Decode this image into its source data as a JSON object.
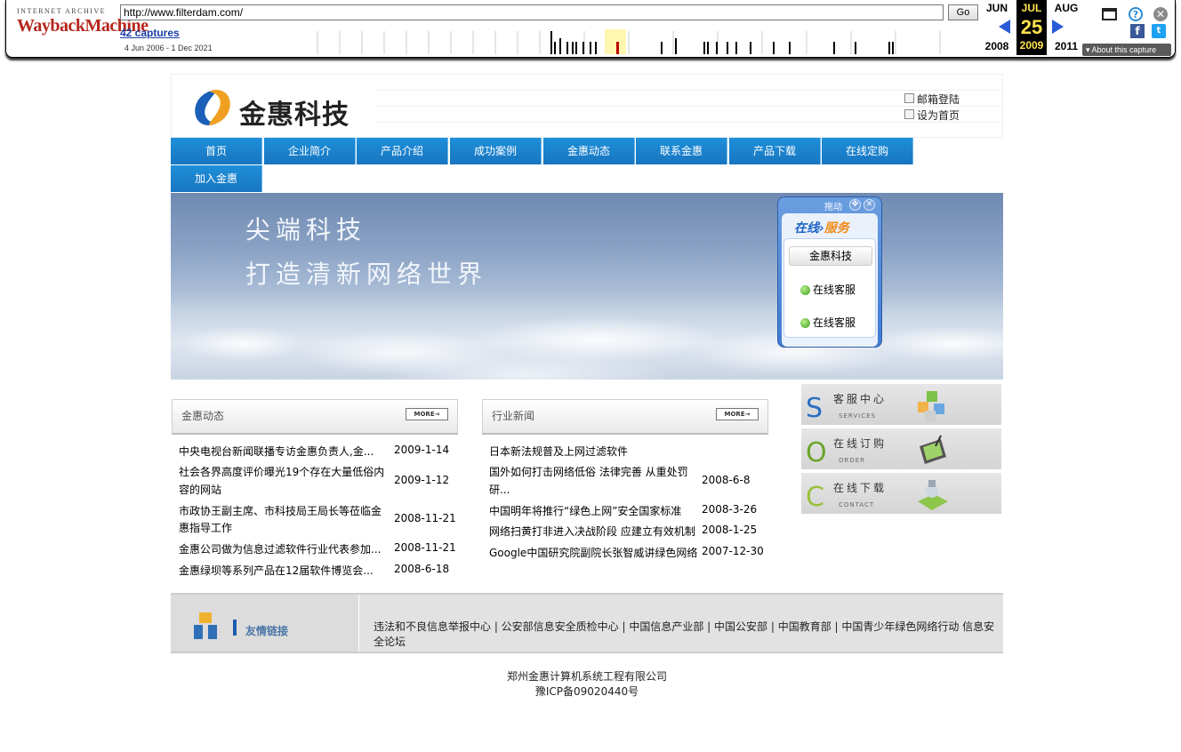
{
  "wayback": {
    "logo_top": "INTERNET ARCHIVE",
    "logo_main": "WaybackMachine",
    "url": "http://www.filterdam.com/",
    "go_label": "Go",
    "captures": "42 captures",
    "range": "4 Jun 2006 - 1 Dec 2021",
    "prev_month": "JUN",
    "cur_month": "JUL",
    "next_month": "AUG",
    "cur_day": "25",
    "prev_year": "2008",
    "cur_year": "2009",
    "next_year": "2011",
    "about": "About this capture",
    "fb": "f",
    "tw": "t",
    "help": "?",
    "close": "✕"
  },
  "site": {
    "logo_text": "金惠科技",
    "top_links": [
      "邮箱登陆",
      "设为首页"
    ],
    "nav": [
      "首页",
      "企业简介",
      "产品介绍",
      "成功案例",
      "金惠动态",
      "联系金惠",
      "产品下载",
      "在线定购",
      "加入金惠"
    ],
    "banner": {
      "line1": "尖端科技",
      "line2": "打造清新网络世界"
    },
    "service": {
      "drag": "拖动",
      "title_a": "在线",
      "title_b": "服务",
      "company": "金惠科技",
      "agents": [
        "在线客服",
        "在线客服"
      ]
    },
    "panel_left": {
      "title": "金惠动态",
      "more": "MORE→",
      "items": [
        {
          "title": "中央电视台新闻联播专访金惠负责人,金...",
          "date": "2009-1-14"
        },
        {
          "title": "社会各界高度评价曝光19个存在大量低俗内",
          "title2": "容的网站",
          "date": "2009-1-12"
        },
        {
          "title": "市政协王副主席、市科技局王局长等莅临金",
          "title2": "惠指导工作",
          "date": "2008-11-21"
        },
        {
          "title": "金惠公司做为信息过滤软件行业代表参加...",
          "date": "2008-11-21"
        },
        {
          "title": "金惠绿坝等系列产品在12届软件博览会...",
          "date": "2008-6-18"
        }
      ]
    },
    "panel_mid": {
      "title": "行业新闻",
      "more": "MORE→",
      "items": [
        {
          "title": "日本新法规普及上网过滤软件",
          "date": ""
        },
        {
          "title": "国外如何打击网络低俗 法律完善 从重处罚",
          "title2": "研...",
          "date": "2008-6-8"
        },
        {
          "title": "中国明年将推行“绿色上网”安全国家标准",
          "date": "2008-3-26"
        },
        {
          "title": "网络扫黄打非进入决战阶段 应建立有效机制",
          "date": "2008-1-25"
        },
        {
          "title": "Google中国研究院副院长张智威讲绿色网络",
          "date": "2007-12-30"
        }
      ]
    },
    "side": [
      {
        "letter": "S",
        "cn": "客服中心",
        "en": "SERVICES",
        "color": "#2b6fc0"
      },
      {
        "letter": "O",
        "cn": "在线订购",
        "en": "ORDER",
        "color": "#6aa52a"
      },
      {
        "letter": "C",
        "cn": "在线下载",
        "en": "CONTACT",
        "color": "#9ac040"
      }
    ],
    "links": {
      "label": "友情链接",
      "text": "违法和不良信息举报中心 | 公安部信息安全质检中心 | 中国信息产业部 | 中国公安部 | 中国教育部 | 中国青少年绿色网络行动 信息安全论坛"
    },
    "footer": {
      "company": "郑州金惠计算机系统工程有限公司",
      "icp": "豫ICP备09020440号"
    }
  }
}
